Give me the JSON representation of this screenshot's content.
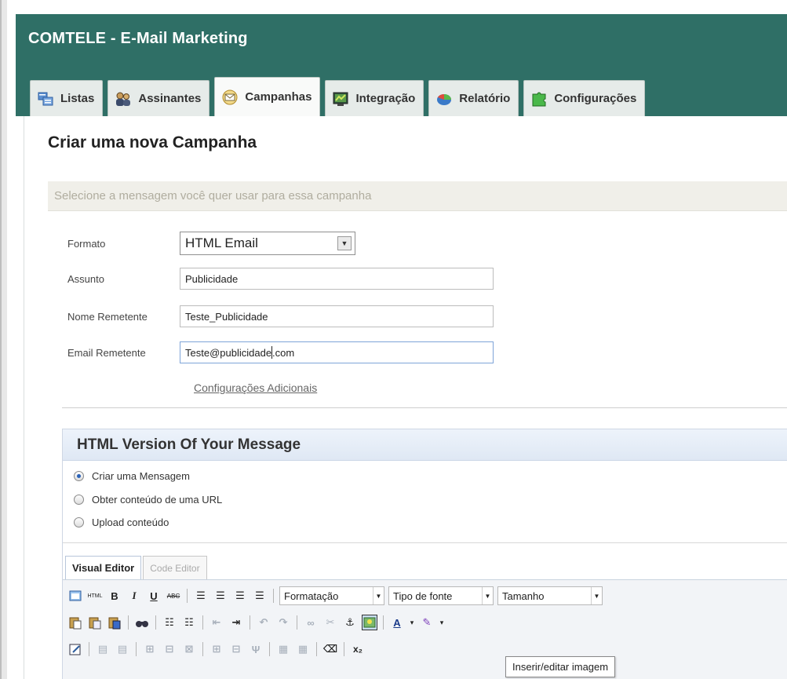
{
  "app": {
    "title": "COMTELE - E-Mail Marketing"
  },
  "tabs": [
    {
      "label": "Listas",
      "icon": "list-icon"
    },
    {
      "label": "Assinantes",
      "icon": "users-icon"
    },
    {
      "label": "Campanhas",
      "icon": "envelope-icon",
      "active": true
    },
    {
      "label": "Integração",
      "icon": "integration-icon"
    },
    {
      "label": "Relatório",
      "icon": "report-pie-icon"
    },
    {
      "label": "Configurações",
      "icon": "settings-puzzle-icon"
    }
  ],
  "page": {
    "title": "Criar uma nova Campanha",
    "section_hint": "Selecione a mensagem você quer usar para essa campanha"
  },
  "form": {
    "format": {
      "label": "Formato",
      "value": "HTML Email"
    },
    "subject": {
      "label": "Assunto",
      "value": "Publicidade"
    },
    "sender_name": {
      "label": "Nome Remetente",
      "value": "Teste_Publicidade"
    },
    "sender_email": {
      "label": "Email Remetente",
      "value_before_caret": "Teste@publicidade",
      "value_after_caret": ".com"
    },
    "additional_link": "Configurações Adicionais"
  },
  "html_panel": {
    "title": "HTML Version Of Your Message",
    "options": [
      {
        "label": "Criar uma Mensagem",
        "checked": true
      },
      {
        "label": "Obter conteúdo de uma URL",
        "checked": false
      },
      {
        "label": "Upload conteúdo",
        "checked": false
      }
    ],
    "editor_tabs": {
      "visual": "Visual Editor",
      "code": "Code Editor"
    }
  },
  "toolbar": {
    "html_label": "HTML",
    "bold": "B",
    "italic": "I",
    "underline": "U",
    "strike": "ABC",
    "format_select": "Formatação",
    "font_select": "Tipo de fonte",
    "size_select": "Tamanho",
    "subscript": "x₂",
    "tooltip": "Inserir/editar imagem"
  },
  "colors": {
    "header_bg": "#2f6f66",
    "tab_bg": "#e6ebe9",
    "section_bar_bg": "#f0efe9",
    "panel_head_bg": "#dfe8f4",
    "radio_checked": "#2a62b8"
  }
}
